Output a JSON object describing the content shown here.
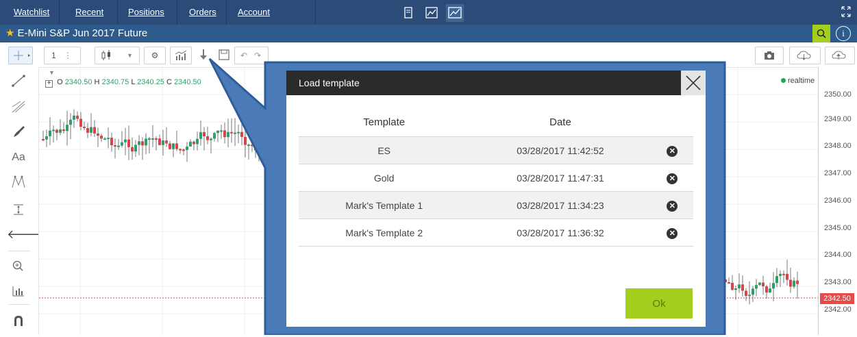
{
  "nav": {
    "tabs": [
      {
        "label": "Watchlist"
      },
      {
        "label": "Recent"
      },
      {
        "label": "Positions"
      },
      {
        "label": "Orders"
      },
      {
        "label": "Account"
      }
    ]
  },
  "instrument": {
    "title": "E-Mini S&P Jun 2017 Future"
  },
  "toolbar": {
    "interval": "1"
  },
  "ohlc": {
    "o_label": "O",
    "o": "2340.50",
    "h_label": "H",
    "h": "2340.75",
    "l_label": "L",
    "l": "2340.25",
    "c_label": "C",
    "c": "2340.50"
  },
  "status": {
    "realtime": "realtime"
  },
  "price_axis": {
    "ticks": [
      "2350.00",
      "2349.00",
      "2348.00",
      "2347.00",
      "2346.00",
      "2345.00",
      "2344.00",
      "2343.00",
      "2342.00"
    ],
    "current": "2342.50"
  },
  "leftbar": {
    "text_tool": "Aa"
  },
  "dialog": {
    "title": "Load template",
    "columns": [
      "Template",
      "Date"
    ],
    "rows": [
      {
        "template": "ES",
        "date": "03/28/2017 11:42:52"
      },
      {
        "template": "Gold",
        "date": "03/28/2017 11:47:31"
      },
      {
        "template": "Mark's Template 1",
        "date": "03/28/2017 11:34:23"
      },
      {
        "template": "Mark's Template 2",
        "date": "03/28/2017 11:36:32"
      }
    ],
    "ok_label": "Ok"
  },
  "colors": {
    "nav_bg": "#2c4b78",
    "title_bg": "#2f5a8c",
    "accent_green": "#a5cf1f",
    "candle_up": "#2e9f6a",
    "candle_down": "#d9434a",
    "callout_blue": "#4a7ab8"
  }
}
